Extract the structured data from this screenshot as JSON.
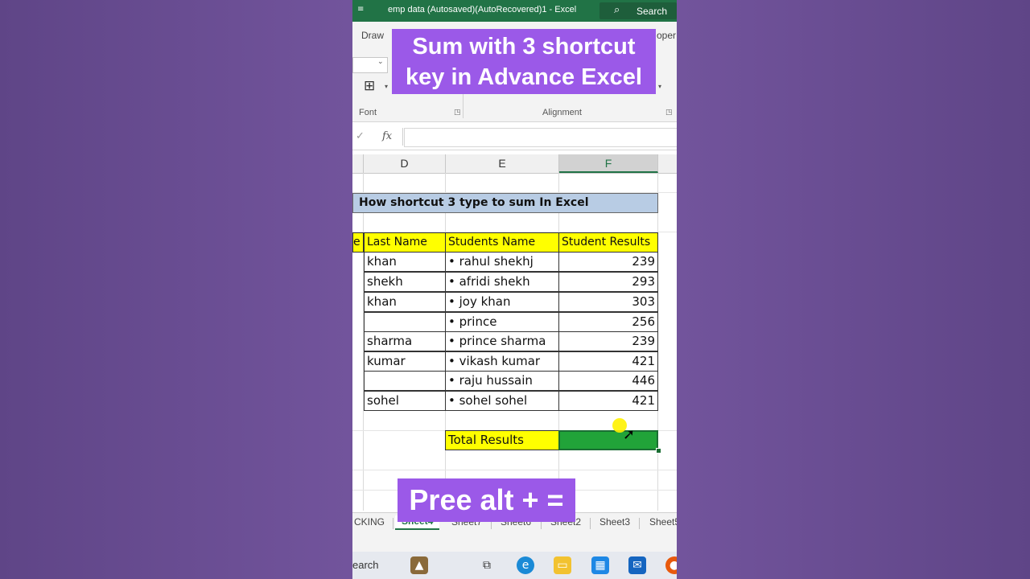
{
  "window": {
    "title": "emp data (Autosaved)(AutoRecovered)1  -  Excel",
    "search_label": "Search",
    "qa_icon": "≡"
  },
  "ribbon": {
    "tab_draw": "Draw",
    "tab_developer_partial": "oper",
    "group_font": "Font",
    "group_alignment": "Alignment"
  },
  "formula_bar": {
    "fx": "fx",
    "value": ""
  },
  "columns": [
    "D",
    "E",
    "F"
  ],
  "sheet": {
    "title": "How shortcut 3 type to sum In Excel",
    "partial_header": "e",
    "headers": [
      "Last Name",
      "Students Name",
      "Student Results"
    ],
    "rows": [
      {
        "last": "khan",
        "student": "• rahul shekhj",
        "result": "239"
      },
      {
        "last": "shekh",
        "student": "• afridi shekh",
        "result": "293"
      },
      {
        "last": "khan",
        "student": "• joy khan",
        "result": "303"
      },
      {
        "last": "",
        "student": "• prince",
        "result": "256"
      },
      {
        "last": "sharma",
        "student": "• prince sharma",
        "result": "239"
      },
      {
        "last": "kumar",
        "student": "• vikash kumar",
        "result": "421"
      },
      {
        "last": "",
        "student": "• raju hussain",
        "result": "446"
      },
      {
        "last": "sohel",
        "student": "• sohel sohel",
        "result": "421"
      }
    ],
    "total_label": "Total Results",
    "total_value": ""
  },
  "sheet_tabs": [
    "CKING",
    "Sheet4",
    "Sheet7",
    "Sheet6",
    "Sheet2",
    "Sheet3",
    "Sheet5"
  ],
  "active_sheet": "Sheet4",
  "taskbar": {
    "search_partial": "earch"
  },
  "overlays": {
    "top_line1": "Sum with 3 shortcut",
    "top_line2": "key in Advance Excel",
    "bottom": "Pree alt + ="
  },
  "colors": {
    "excel_green": "#217346",
    "header_yellow": "#ffff00",
    "title_blue": "#b8cce4",
    "overlay_purple": "#9b59e8",
    "selection_green": "#21a339",
    "background_purple": "#6b4f93"
  }
}
